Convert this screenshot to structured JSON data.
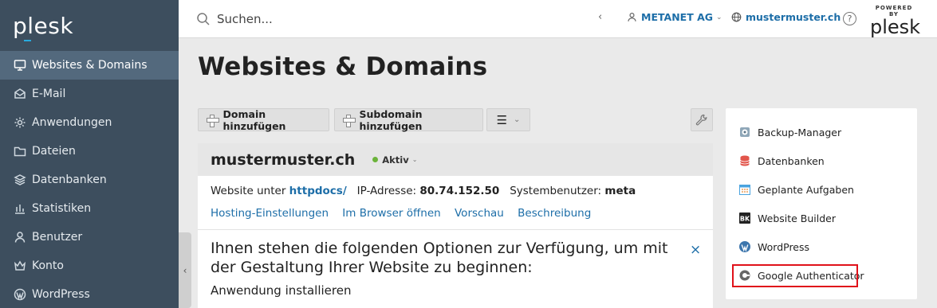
{
  "sidebar": {
    "logo": "plesk",
    "items": [
      {
        "label": "Websites & Domains",
        "icon": "monitor-icon",
        "active": true
      },
      {
        "label": "E-Mail",
        "icon": "mail-icon"
      },
      {
        "label": "Anwendungen",
        "icon": "gear-icon"
      },
      {
        "label": "Dateien",
        "icon": "folder-icon"
      },
      {
        "label": "Datenbanken",
        "icon": "layers-icon"
      },
      {
        "label": "Statistiken",
        "icon": "bar-chart-icon"
      },
      {
        "label": "Benutzer",
        "icon": "user-icon"
      },
      {
        "label": "Konto",
        "icon": "crown-icon"
      },
      {
        "label": "WordPress",
        "icon": "wordpress-icon"
      }
    ],
    "collapse_glyph": "‹"
  },
  "header": {
    "search_placeholder": "Suchen...",
    "back_glyph": "‹",
    "account": "METANET AG",
    "domain": "mustermuster.ch",
    "help_glyph": "?",
    "powered_by": "POWERED BY",
    "brand": "plesk"
  },
  "main": {
    "title": "Websites & Domains",
    "toolbar": {
      "add_domain": "Domain hinzufügen",
      "add_subdomain": "Subdomain hinzufügen",
      "menu_glyph": "☰",
      "menu_caret": "⌄"
    },
    "card": {
      "domain": "mustermuster.ch",
      "status": "Aktiv",
      "website_prefix": "Website unter",
      "docroot": "httpdocs/",
      "ip_label": "IP-Adresse:",
      "ip": "80.74.152.50",
      "sysuser_label": "Systembenutzer:",
      "sysuser": "meta",
      "links": [
        "Hosting-Einstellungen",
        "Im Browser öffnen",
        "Vorschau",
        "Beschreibung"
      ],
      "options_text": "Ihnen stehen die folgenden Optionen zur Verfügung, um mit der Gestaltung Ihrer Website zu beginnen:",
      "install_app": "Anwendung installieren",
      "close_glyph": "×"
    }
  },
  "right_panel": {
    "items": [
      {
        "label": "Backup-Manager",
        "icon": "backup-icon"
      },
      {
        "label": "Datenbanken",
        "icon": "database-icon"
      },
      {
        "label": "Geplante Aufgaben",
        "icon": "calendar-icon"
      },
      {
        "label": "Website Builder",
        "icon": "website-builder-icon"
      },
      {
        "label": "WordPress",
        "icon": "wordpress-icon"
      },
      {
        "label": "Google Authenticator",
        "icon": "google-authenticator-icon"
      }
    ]
  },
  "colors": {
    "sidebar_bg": "#3d4e5e",
    "sidebar_active": "#53697d",
    "link": "#1d6ea8",
    "status_active": "#6bb33a",
    "highlight": "#e0111a"
  }
}
